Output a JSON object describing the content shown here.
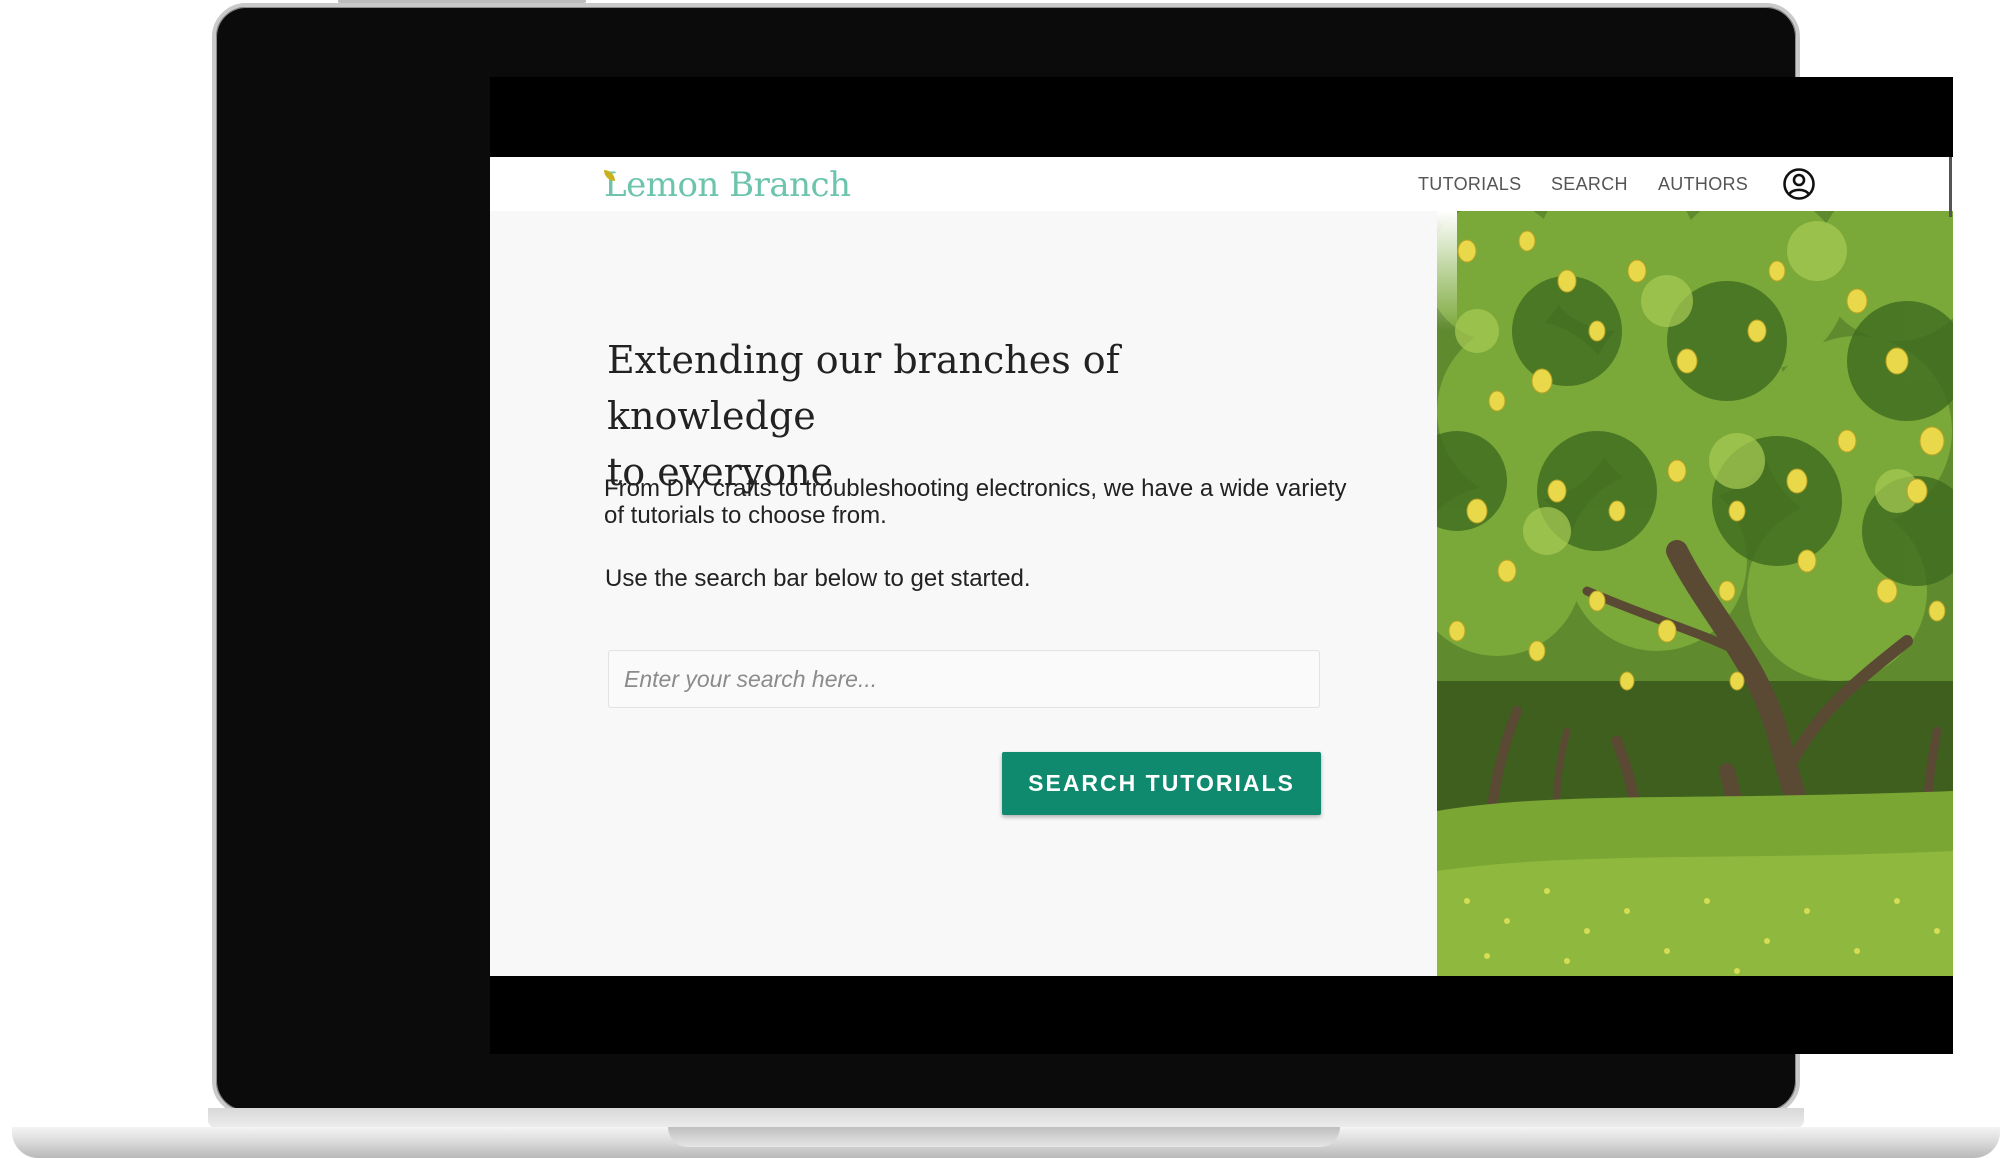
{
  "site": {
    "logo": "Lemon Branch",
    "nav": {
      "tutorials": "TUTORIALS",
      "search": "SEARCH",
      "authors": "AUTHORS"
    },
    "account_icon": "account-circle-icon"
  },
  "hero": {
    "title_line1": "Extending our branches of knowledge",
    "title_line2": "to everyone",
    "description": "From DIY crafts to troubleshooting electronics, we have a wide variety of tutorials to choose from.",
    "cta_text": "Use the search bar below to get started.",
    "search_placeholder": "Enter your search here...",
    "search_value": "",
    "button_label": "SEARCH TUTORIALS"
  },
  "image": {
    "subject": "lemon-grove-photo"
  },
  "colors": {
    "brand": "#6cc4ad",
    "button": "#0f8a6e",
    "background": "#f8f8f8"
  }
}
